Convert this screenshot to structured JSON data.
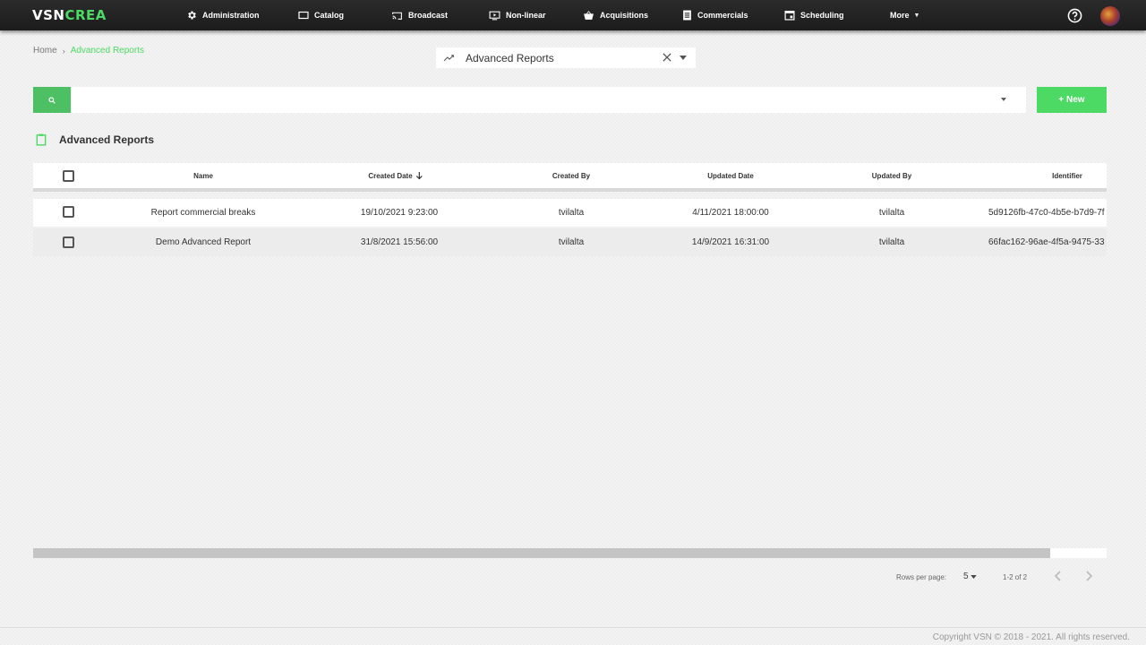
{
  "brand": {
    "part1": "VSN",
    "part2": "CREA"
  },
  "nav": {
    "administration": "Administration",
    "catalog": "Catalog",
    "broadcast": "Broadcast",
    "nonlinear": "Non-linear",
    "acquisitions": "Acquisitions",
    "commercials": "Commercials",
    "scheduling": "Scheduling",
    "more": "More"
  },
  "breadcrumb": {
    "home": "Home",
    "current": "Advanced Reports"
  },
  "selector": {
    "label": "Advanced Reports"
  },
  "search": {
    "value": "",
    "placeholder": ""
  },
  "new_button": "+ New",
  "section_title": "Advanced Reports",
  "table": {
    "headers": {
      "name": "Name",
      "created_date": "Created Date",
      "created_by": "Created By",
      "updated_date": "Updated Date",
      "updated_by": "Updated By",
      "identifier": "Identifier"
    },
    "rows": [
      {
        "name": "Report commercial breaks",
        "created_date": "19/10/2021 9:23:00",
        "created_by": "tvilalta",
        "updated_date": "4/11/2021 18:00:00",
        "updated_by": "tvilalta",
        "identifier": "5d9126fb-47c0-4b5e-b7d9-7f"
      },
      {
        "name": "Demo Advanced Report",
        "created_date": "31/8/2021 15:56:00",
        "created_by": "tvilalta",
        "updated_date": "14/9/2021 16:31:00",
        "updated_by": "tvilalta",
        "identifier": "66fac162-96ae-4f5a-9475-33"
      }
    ]
  },
  "pagination": {
    "rows_per_page_label": "Rows per page:",
    "rows_per_page": "5",
    "range": "1-2 of 2"
  },
  "footer": {
    "copyright": "Copyright VSN © 2018 - 2021. All rights reserved."
  },
  "colors": {
    "accent": "#4cd964",
    "search_button": "#4cc062",
    "topbar": "#222222"
  },
  "icons": {
    "administration": "gear-icon",
    "catalog": "folder-icon",
    "broadcast": "cast-icon",
    "nonlinear": "play-box-icon",
    "acquisitions": "basket-icon",
    "commercials": "list-box-icon",
    "scheduling": "calendar-icon",
    "help": "help-icon",
    "selector": "trending-up-icon",
    "section": "clipboard-icon",
    "search": "search-icon"
  }
}
